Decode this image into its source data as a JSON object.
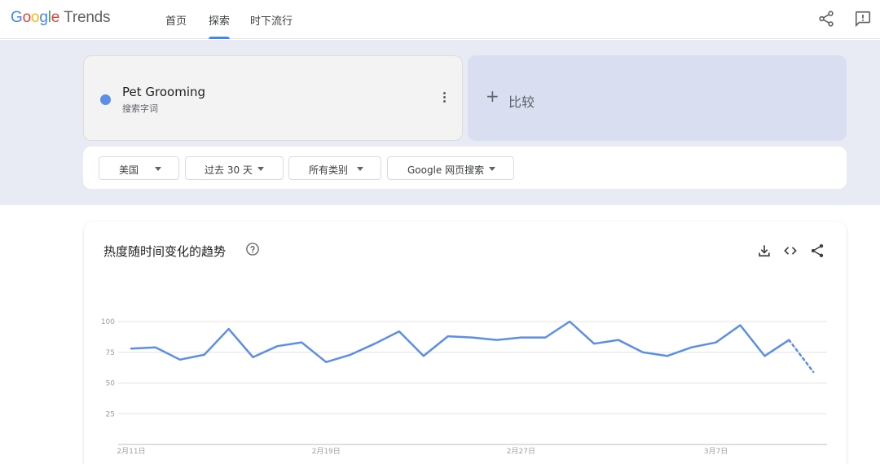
{
  "header": {
    "logo_google": "Google",
    "logo_trends": "Trends",
    "tabs": [
      {
        "label": "首页",
        "active": false
      },
      {
        "label": "探索",
        "active": true
      },
      {
        "label": "时下流行",
        "active": false
      }
    ],
    "icons": [
      "share-icon",
      "feedback-icon"
    ]
  },
  "search_term": {
    "name": "Pet Grooming",
    "type": "搜索字词",
    "dot_color": "#5c8ee6"
  },
  "compare": {
    "plus": "+",
    "label": "比较"
  },
  "filters": {
    "region": "美国",
    "time": "过去 30 天",
    "category": "所有类别",
    "search_type": "Google 网页搜索"
  },
  "chart_card": {
    "title": "热度随时间变化的趋势",
    "icons": [
      "help-icon",
      "download-icon",
      "embed-icon",
      "share-icon"
    ]
  },
  "chart_data": {
    "type": "line",
    "y_ticks": [
      "100",
      "75",
      "50",
      "25"
    ],
    "ylim": [
      0,
      100
    ],
    "x_tick_labels": [
      {
        "label": "2月11日",
        "index": 0
      },
      {
        "label": "2月19日",
        "index": 8
      },
      {
        "label": "2月27日",
        "index": 16
      },
      {
        "label": "3月7日",
        "index": 24
      }
    ],
    "series": [
      {
        "color": "#5c8ee6",
        "values": [
          78,
          79,
          69,
          73,
          94,
          71,
          80,
          83,
          67,
          73,
          82,
          92,
          72,
          88,
          87,
          85,
          87,
          87,
          100,
          82,
          85,
          75,
          72,
          79,
          83,
          97,
          72,
          85,
          59
        ],
        "partial_from_index": 27
      }
    ]
  }
}
